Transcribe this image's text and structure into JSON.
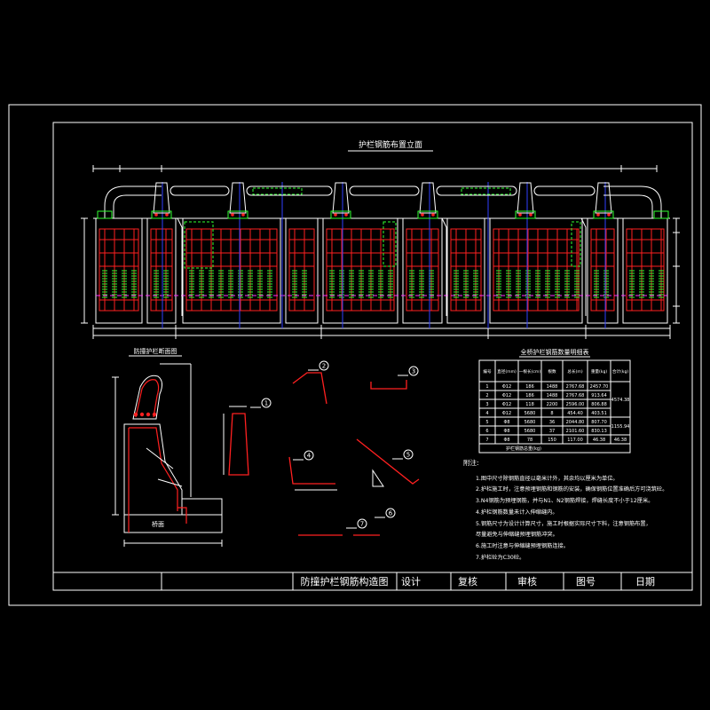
{
  "title_block": {
    "drawing_name": "防撞护栏钢筋构造图",
    "design": "设计",
    "check": "复核",
    "review": "审核",
    "drawing_no": "图号",
    "date": "日期"
  },
  "elevation": {
    "title": "护栏钢筋布置立面"
  },
  "section": {
    "title": "防撞护栏断面图",
    "deck_label": "桥面"
  },
  "table": {
    "title": "全桥护栏钢筋数量明细表",
    "headers": [
      "编号",
      "直径(mm)",
      "一根长(cm)",
      "根数",
      "总长(m)",
      "重量(kg)",
      "合计(kg)"
    ],
    "rows": [
      [
        "1",
        "Φ12",
        "186",
        "1488",
        "2767.68",
        "2457.70"
      ],
      [
        "2",
        "Φ12",
        "186",
        "1488",
        "2767.68",
        "913.64"
      ],
      [
        "3",
        "Φ12",
        "118",
        "2200",
        "2596.00",
        "806.88"
      ],
      [
        "4",
        "Φ12",
        "5680",
        "8",
        "454.40",
        "403.51"
      ],
      [
        "5",
        "Φ8",
        "5680",
        "36",
        "2044.80",
        "807.70"
      ],
      [
        "6",
        "Φ8",
        "5680",
        "37",
        "2101.60",
        "830.13"
      ],
      [
        "7",
        "Φ8",
        "78",
        "150",
        "117.00",
        "46.38"
      ]
    ],
    "merged_totals": [
      "4574.38",
      "1155.94",
      "46.38"
    ],
    "footer": "护栏钢筋总重(kg)"
  },
  "notes": {
    "heading": "附注:",
    "items": [
      "1.图中尺寸除钢筋直径以毫米计外，其余均以厘米为单位。",
      "2.护栏施工时，注意预埋钢筋和钢筋的安装，确保钢筋位置准确后方可浇筑砼。",
      "3.N4钢筋为预埋钢筋，并与N1、N2钢筋焊接，焊缝长度不小于12厘米。",
      "4.护栏钢筋数量未计入伸缩缝内。",
      "5.钢筋尺寸为设计计算尺寸，施工时根据实际尺寸下料，注意钢筋布置，",
      "   尽量避免与伸缩缝预埋钢筋冲突。",
      "6.施工时注意与伸缩缝预埋钢筋连接。",
      "7.护栏砼为C30砼。"
    ]
  },
  "bar_marks": [
    "1",
    "2",
    "3",
    "4",
    "5",
    "6",
    "7"
  ],
  "colors": {
    "background": "#000000",
    "line": "#ffffff",
    "rebar": "#ff2020",
    "hatch": "#30ff30",
    "axis": "#3040ff",
    "dashed": "#ff30ff"
  }
}
